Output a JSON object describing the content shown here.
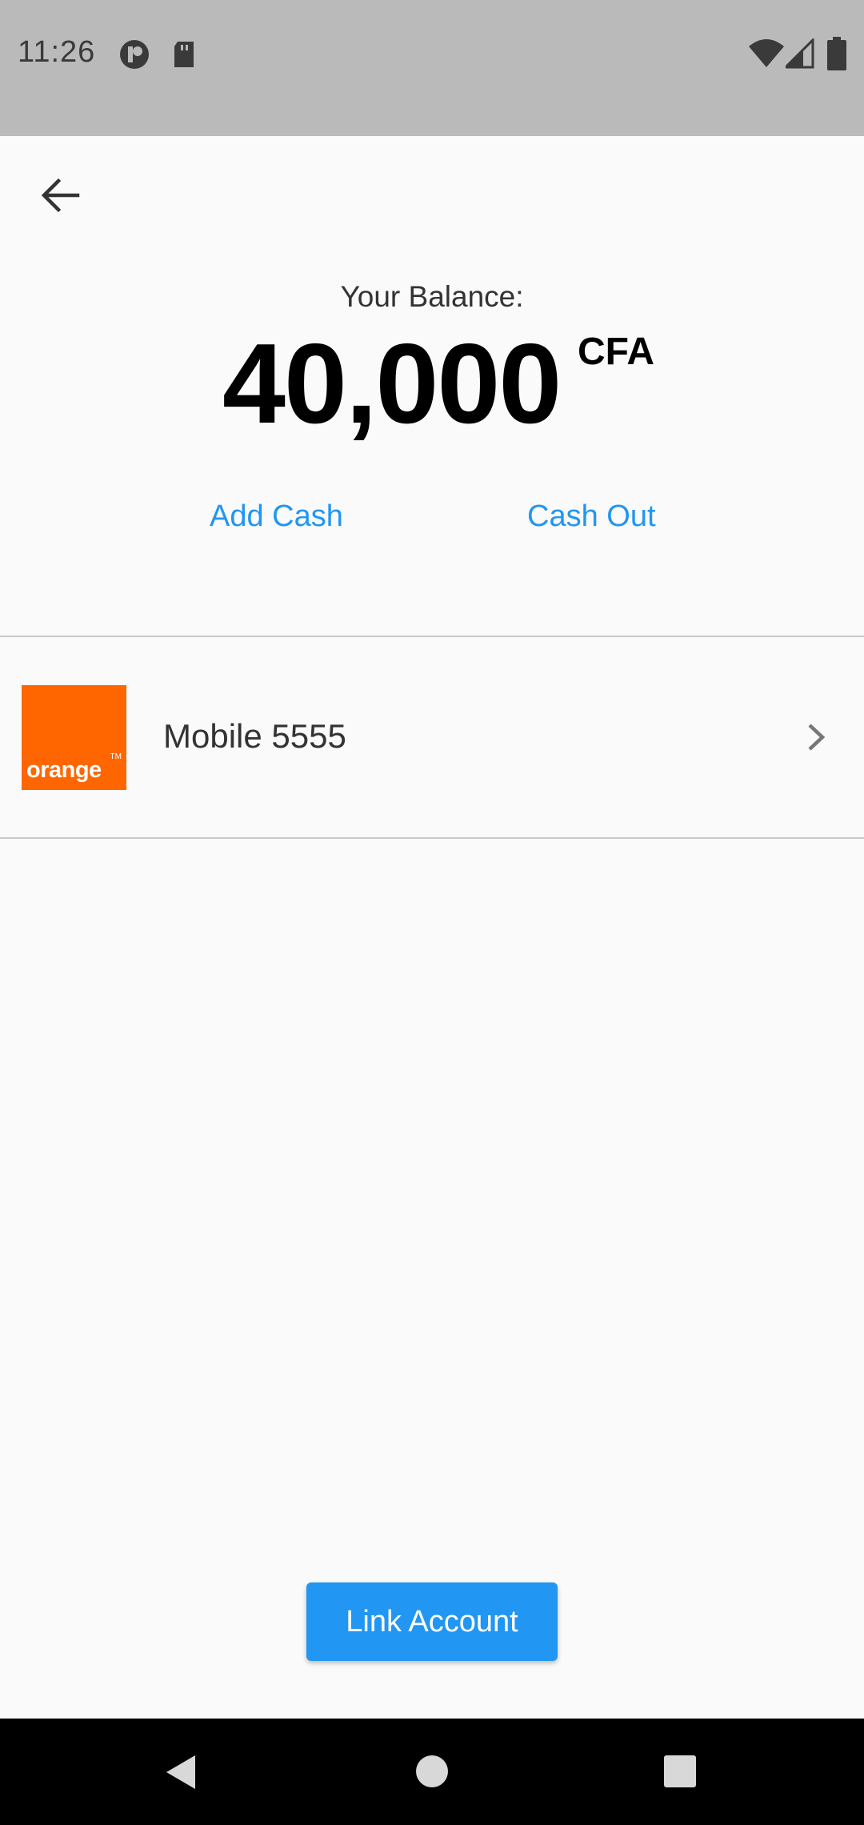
{
  "status_bar": {
    "time": "11:26"
  },
  "app_bar": {
    "back_icon": "arrow-back-icon"
  },
  "balance": {
    "label": "Your Balance:",
    "amount": "40,000",
    "currency": "CFA"
  },
  "actions": {
    "add_cash": "Add Cash",
    "cash_out": "Cash Out"
  },
  "accounts": [
    {
      "logo_text": "orange",
      "logo_tm": "TM",
      "name": "Mobile 5555"
    }
  ],
  "footer": {
    "link_account": "Link Account"
  },
  "colors": {
    "accent": "#2196f3",
    "orange_brand": "#ff6600",
    "status_bar": "#bababa"
  }
}
